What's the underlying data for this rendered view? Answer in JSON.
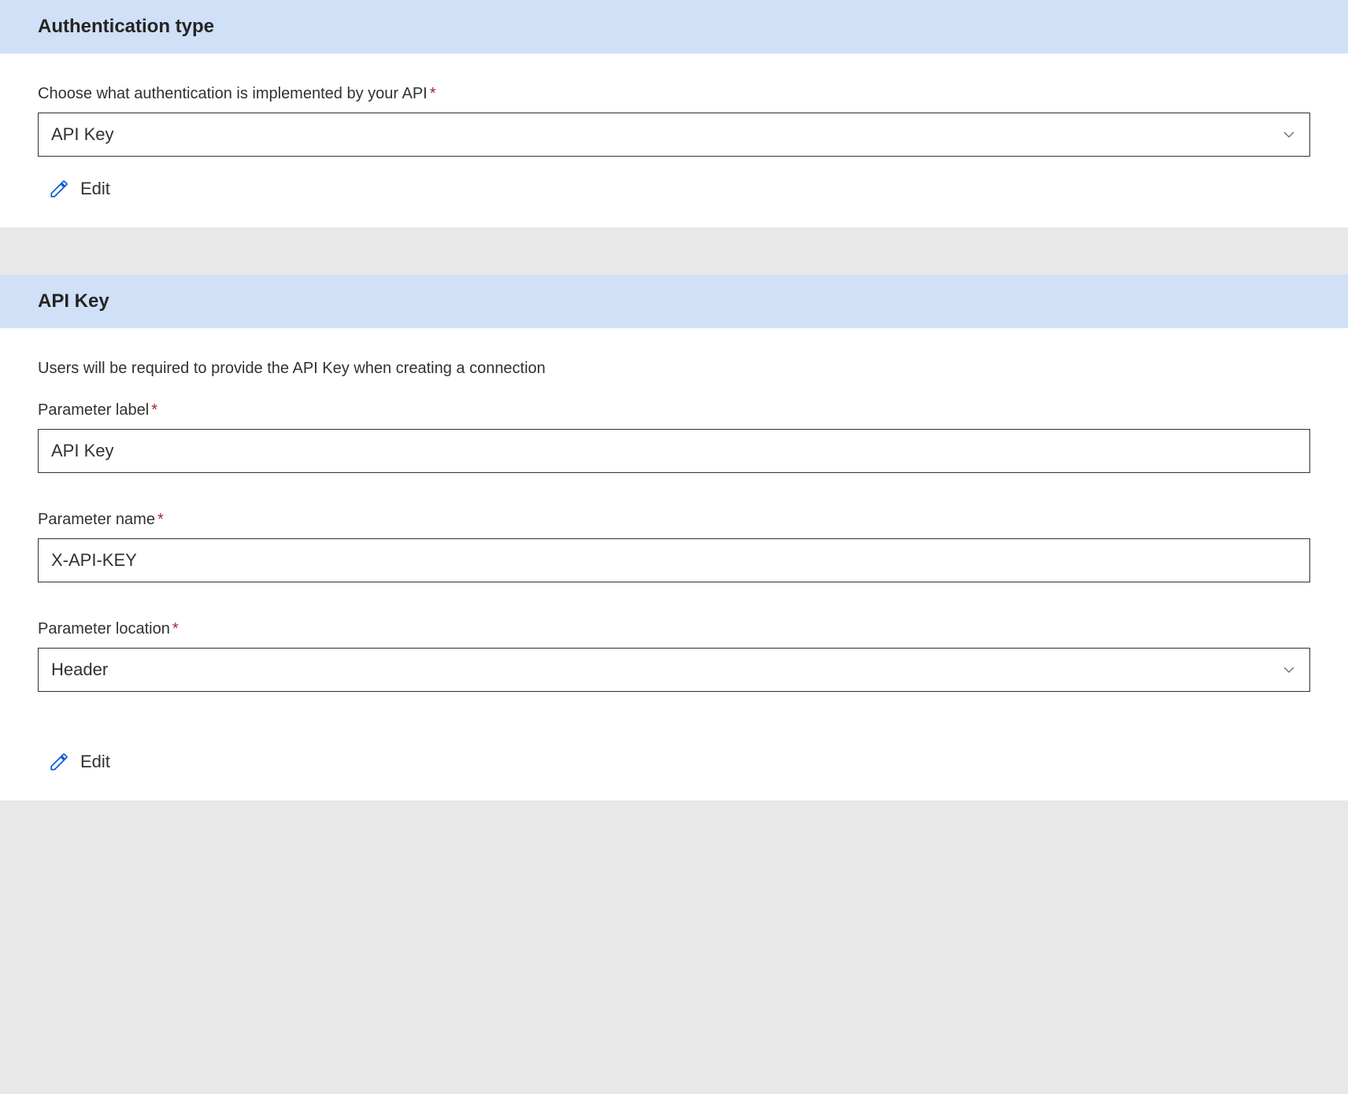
{
  "auth_type_section": {
    "header": "Authentication type",
    "label": "Choose what authentication is implemented by your API",
    "value": "API Key",
    "edit_label": "Edit"
  },
  "api_key_section": {
    "header": "API Key",
    "description": "Users will be required to provide the API Key when creating a connection",
    "parameter_label": {
      "label": "Parameter label",
      "value": "API Key"
    },
    "parameter_name": {
      "label": "Parameter name",
      "value": "X-API-KEY"
    },
    "parameter_location": {
      "label": "Parameter location",
      "value": "Header"
    },
    "edit_label": "Edit"
  }
}
